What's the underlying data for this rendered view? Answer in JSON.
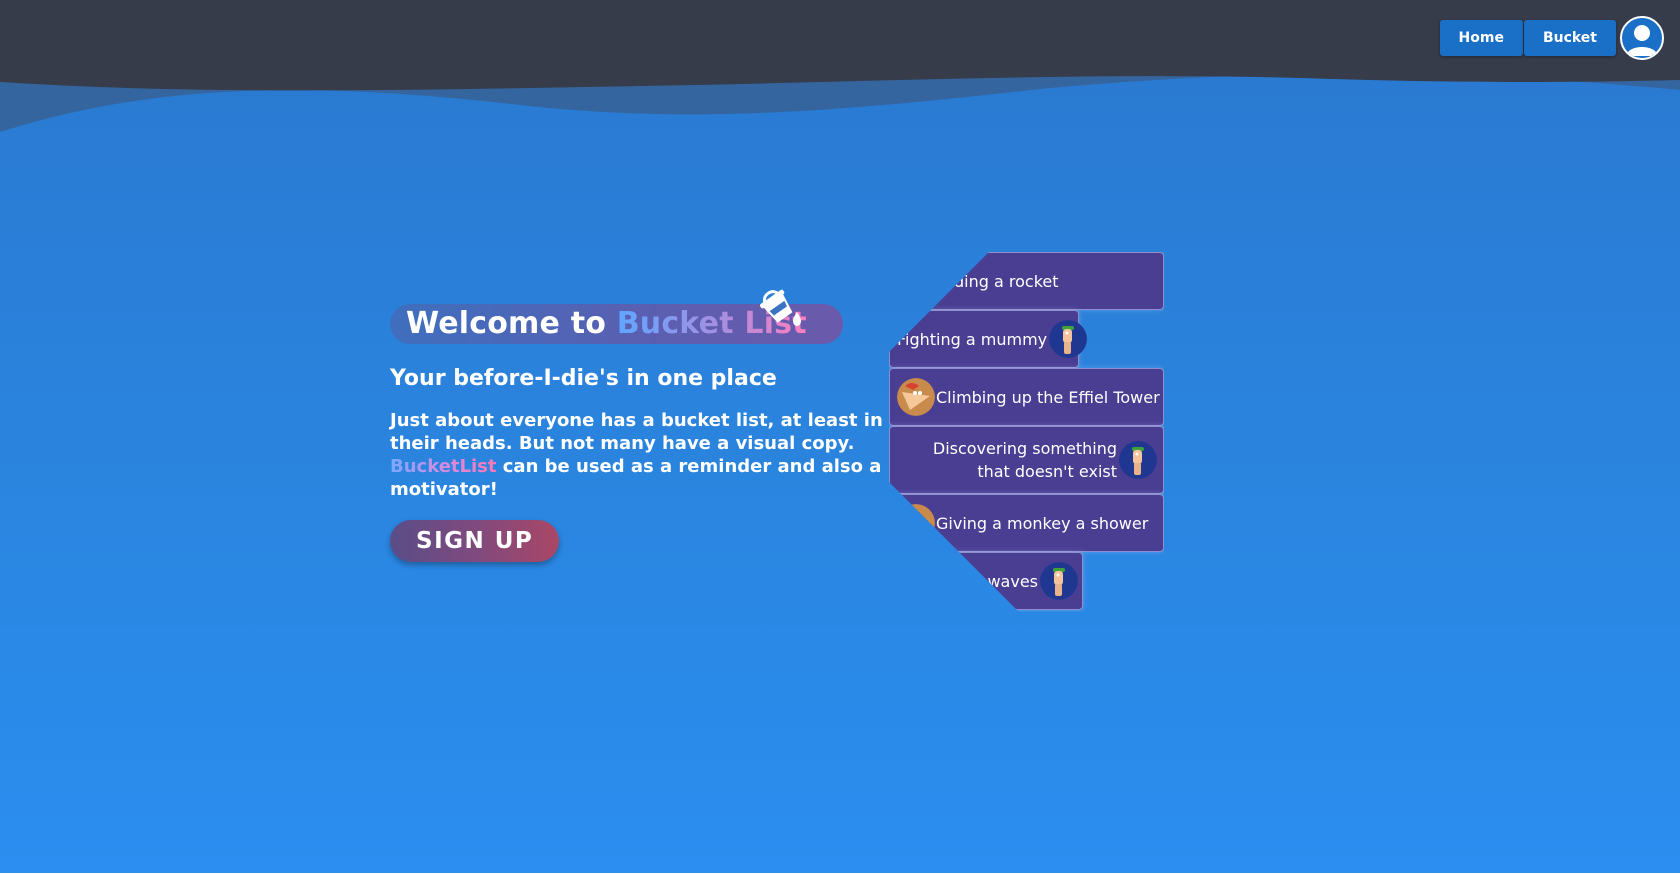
{
  "nav": {
    "home_label": "Home",
    "bucket_label": "Bucket",
    "avatar_icon": "user-circle-icon"
  },
  "hero": {
    "title_prefix": "Welcome to",
    "title_brand": "Bucket List",
    "brand_icon": "paint-bucket-icon",
    "subtitle": "Your before-I-die's in one place",
    "description_part1": "Just about everyone has a bucket list, at least in their heads. But not many have a visual copy.",
    "description_brand": "BucketList",
    "description_part2": "can be used as a reminder and also a motivator!",
    "signup_label": "SIGN UP"
  },
  "bucket_items": [
    {
      "label": "Building a rocket",
      "character": "ferb"
    },
    {
      "label": "Fighting a mummy",
      "character": "ferb"
    },
    {
      "label": "Climbing up the Effiel Tower",
      "character": "phineas"
    },
    {
      "label": "Discovering something that doesn't exist",
      "character": "ferb"
    },
    {
      "label": "Giving a monkey a shower",
      "character": "phineas"
    },
    {
      "label": "Surfing tidal waves",
      "character": "ferb"
    }
  ],
  "colors": {
    "header_bg": "#363c4a",
    "wave_mid": "#3567a7",
    "page_bg": "#2a80db",
    "nav_button": "#1a6fc7",
    "card_bg": "#4a3e93",
    "brand_gradient_start": "#60a6ff",
    "brand_gradient_end": "#ff7ec0"
  }
}
